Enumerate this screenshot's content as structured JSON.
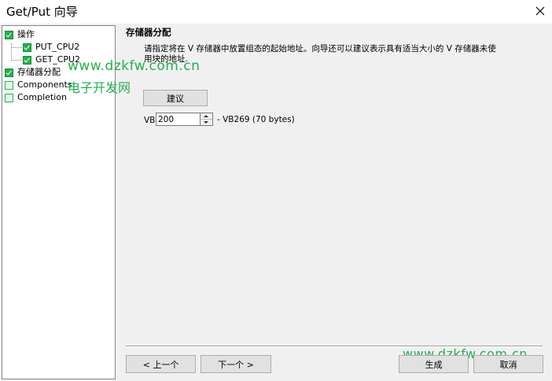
{
  "window": {
    "title": "Get/Put 向导",
    "close_icon": "close-icon"
  },
  "tree": {
    "items": [
      {
        "label": "操作",
        "checked": true
      },
      {
        "label": "PUT_CPU2",
        "checked": true
      },
      {
        "label": "GET_CPU2",
        "checked": true
      },
      {
        "label": "存储器分配",
        "checked": true
      },
      {
        "label": "Components",
        "checked": false
      },
      {
        "label": "Completion",
        "checked": false
      }
    ]
  },
  "watermark": {
    "url_top": "www.dzkfw.com.cn",
    "site_name": "电子开发网",
    "url_bottom": "www.dzkfw.com.cn"
  },
  "main": {
    "section_title": "存储器分配",
    "description": "请指定将在 V 存储器中放置组态的起始地址。向导还可以建议表示具有适当大小的 V 存储器未使用块的地址.",
    "suggest_label": "建议",
    "vb_prefix": "VB",
    "vb_value": "200",
    "range_text": "- VB269 (70 bytes)"
  },
  "footer": {
    "prev_label": "< 上一个",
    "next_label": "下一个 >",
    "finish_label": "生成",
    "cancel_label": "取消"
  },
  "colors": {
    "check_green": "#22b14c",
    "watermark_green": "#22b14c"
  }
}
